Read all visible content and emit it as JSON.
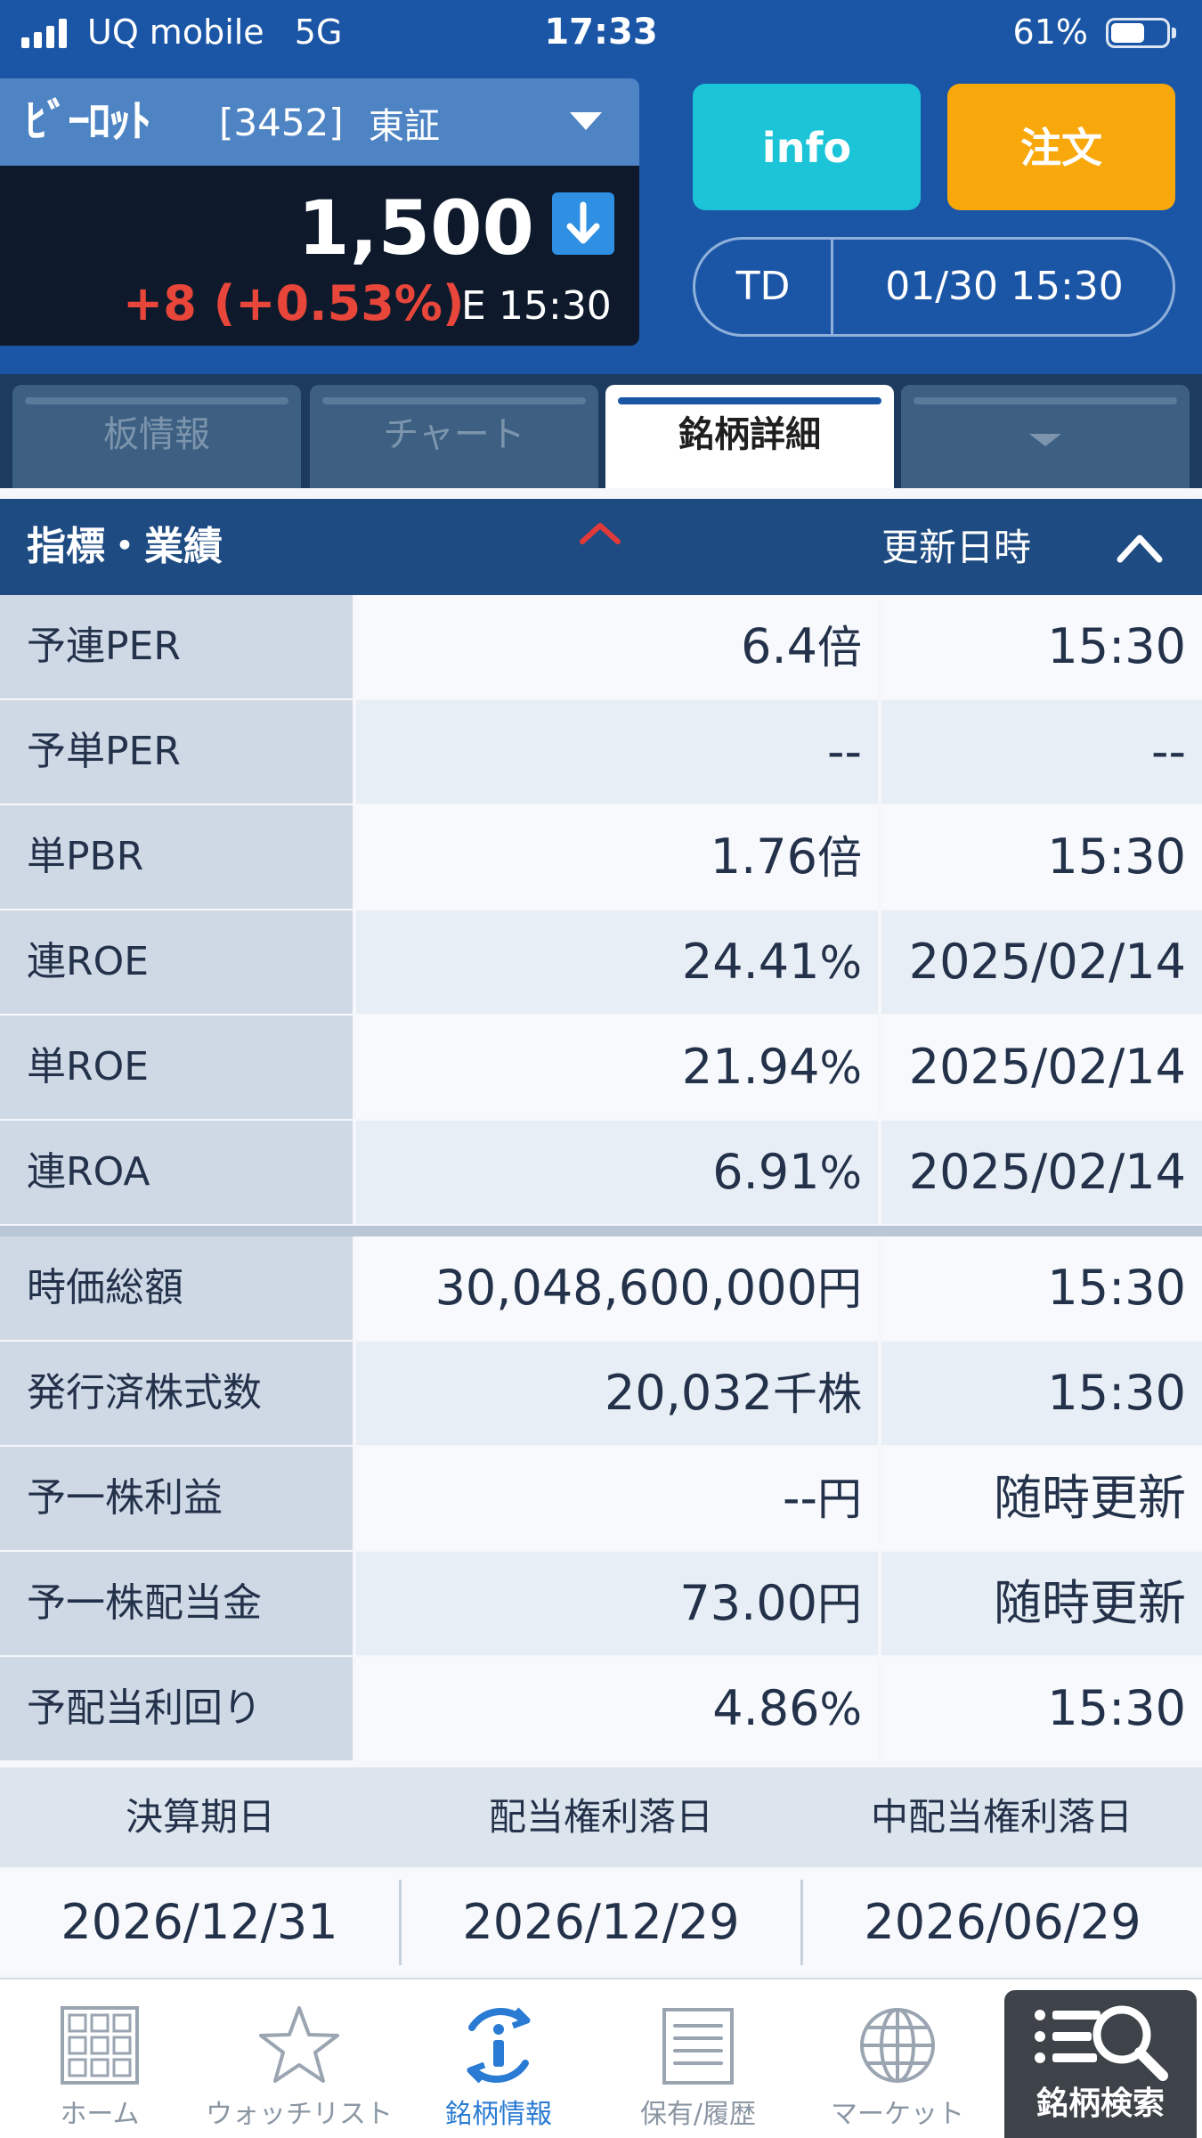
{
  "status_bar": {
    "carrier": "UQ mobile",
    "network": "5G",
    "time": "17:33",
    "battery_pct": "61%",
    "battery_level": 0.61
  },
  "stock": {
    "name": "ﾋﾞｰﾛｯﾄ",
    "code": "[3452]",
    "market": "東証",
    "price": "1,500",
    "change": "+8 (+0.53%)",
    "time_prefix": "E",
    "time": "15:30"
  },
  "actions": {
    "info_label": "info",
    "order_label": "注文",
    "td_label": "TD",
    "td_datetime": "01/30 15:30"
  },
  "tabs": [
    {
      "label": "板情報"
    },
    {
      "label": "チャート"
    },
    {
      "label": "銘柄詳細"
    },
    {
      "label": ""
    }
  ],
  "section": {
    "title": "指標・業績",
    "updated_label": "更新日時"
  },
  "metrics": [
    {
      "label": "予連PER",
      "value": "6.4",
      "unit": "倍",
      "date": "15:30"
    },
    {
      "label": "予単PER",
      "value": "--",
      "unit": "",
      "date": "--"
    },
    {
      "label": "単PBR",
      "value": "1.76",
      "unit": "倍",
      "date": "15:30"
    },
    {
      "label": "連ROE",
      "value": "24.41",
      "unit": "%",
      "date": "2025/02/14"
    },
    {
      "label": "単ROE",
      "value": "21.94",
      "unit": "%",
      "date": "2025/02/14"
    },
    {
      "label": "連ROA",
      "value": "6.91",
      "unit": "%",
      "date": "2025/02/14"
    },
    {
      "label": "時価総額",
      "value": "30,048,600,000",
      "unit": "円",
      "date": "15:30"
    },
    {
      "label": "発行済株式数",
      "value": "20,032",
      "unit": "千株",
      "date": "15:30"
    },
    {
      "label": "予一株利益",
      "value": "--",
      "unit": "円",
      "date": "随時更新"
    },
    {
      "label": "予一株配当金",
      "value": "73.00",
      "unit": "円",
      "date": "随時更新"
    },
    {
      "label": "予配当利回り",
      "value": "4.86",
      "unit": "%",
      "date": "15:30"
    }
  ],
  "dates": {
    "headers": [
      "決算期日",
      "配当権利落日",
      "中配当権利落日"
    ],
    "values": [
      "2026/12/31",
      "2026/12/29",
      "2026/06/29"
    ]
  },
  "nav": {
    "items": [
      {
        "label": "ホーム",
        "icon": "home-grid-icon"
      },
      {
        "label": "ウォッチリスト",
        "icon": "star-icon"
      },
      {
        "label": "銘柄情報",
        "icon": "stock-info-icon"
      },
      {
        "label": "保有/履歴",
        "icon": "list-icon"
      },
      {
        "label": "マーケット",
        "icon": "globe-icon"
      }
    ],
    "search_label": "銘柄検索"
  },
  "colors": {
    "header_blue": "#1b56a6",
    "info_button": "#1cc4d8",
    "order_button": "#f9a80c",
    "change_red": "#e8463a",
    "nav_active": "#2a7bd3"
  }
}
